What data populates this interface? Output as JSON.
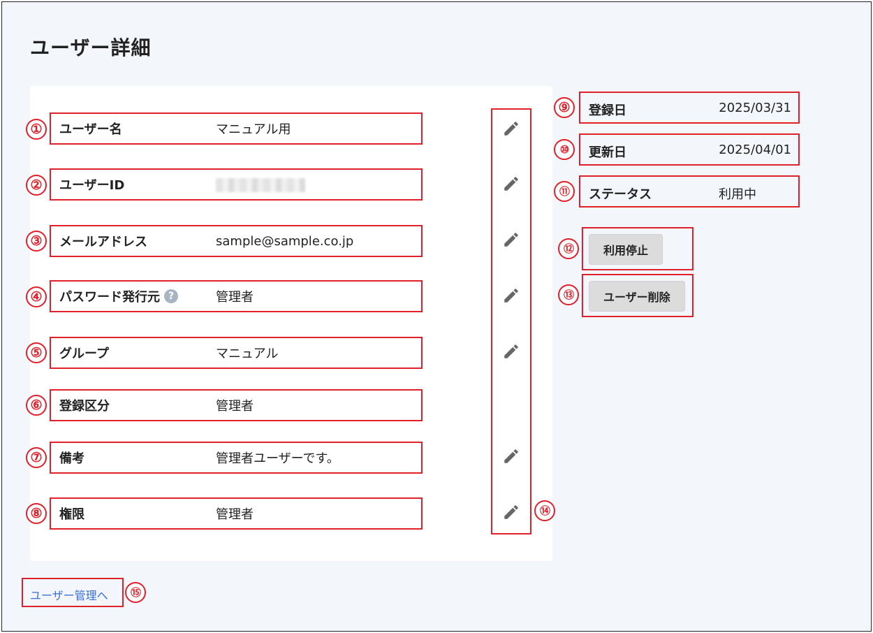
{
  "page": {
    "title": "ユーザー詳細"
  },
  "fields": [
    {
      "label": "ユーザー名",
      "value": "マニュアル用",
      "marker": "①"
    },
    {
      "label": "ユーザーID",
      "value": "",
      "marker": "②"
    },
    {
      "label": "メールアドレス",
      "value": "sample@sample.co.jp",
      "marker": "③"
    },
    {
      "label": "パスワード発行元",
      "value": "管理者",
      "marker": "④",
      "help_icon": "question-circle-icon"
    },
    {
      "label": "グループ",
      "value": "マニュアル",
      "marker": "⑤"
    },
    {
      "label": "登録区分",
      "value": "管理者",
      "marker": "⑥"
    },
    {
      "label": "備考",
      "value": "管理者ユーザーです。",
      "marker": "⑦"
    },
    {
      "label": "権限",
      "value": "管理者",
      "marker": "⑧"
    }
  ],
  "help": {
    "glyph": "?"
  },
  "edit_column": {
    "marker": "⑭",
    "icon": "pencil-icon"
  },
  "side_info": [
    {
      "label": "登録日",
      "value": "2025/03/31",
      "marker": "⑨"
    },
    {
      "label": "更新日",
      "value": "2025/04/01",
      "marker": "⑩"
    },
    {
      "label": "ステータス",
      "value": "利用中",
      "marker": "⑪"
    }
  ],
  "actions": {
    "suspend": {
      "label": "利用停止",
      "marker": "⑫"
    },
    "delete": {
      "label": "ユーザー削除",
      "marker": "⑬"
    }
  },
  "back_link": {
    "label": "ユーザー管理へ",
    "marker": "⑮"
  },
  "colors": {
    "annotation_red": "#e0202a",
    "link_blue": "#3a6fd8",
    "background": "#f3f6fa",
    "button_gray": "#dcdcdc"
  }
}
